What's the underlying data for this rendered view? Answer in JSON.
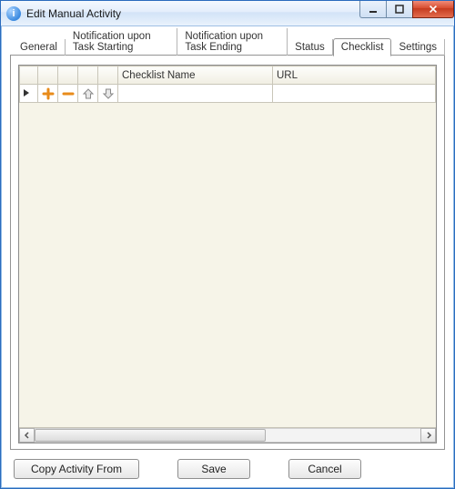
{
  "window": {
    "title": "Edit Manual Activity"
  },
  "tabs": [
    {
      "label": "General"
    },
    {
      "label": "Notification upon Task Starting"
    },
    {
      "label": "Notification upon Task Ending"
    },
    {
      "label": "Status"
    },
    {
      "label": "Checklist"
    },
    {
      "label": "Settings"
    }
  ],
  "active_tab_index": 4,
  "checklist": {
    "columns": {
      "name": "Checklist Name",
      "url": "URL"
    },
    "rows": [
      {
        "name": "",
        "url": ""
      }
    ],
    "row_buttons": {
      "add": "add-icon",
      "remove": "remove-icon",
      "up": "up-arrow-icon",
      "down": "down-arrow-icon"
    }
  },
  "buttons": {
    "copy_from": "Copy Activity From",
    "save": "Save",
    "cancel": "Cancel"
  }
}
